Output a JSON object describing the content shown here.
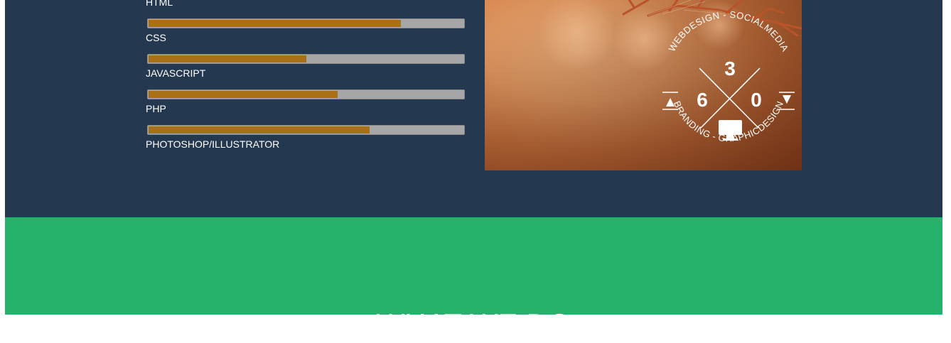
{
  "skills": {
    "items": [
      {
        "label": "HTML",
        "level_percent": 80
      },
      {
        "label": "CSS",
        "level_percent": 50
      },
      {
        "label": "JAVASCRIPT",
        "level_percent": 60
      },
      {
        "label": "PHP",
        "level_percent": 70
      },
      {
        "label": "PHOTOSHOP/ILLUSTRATOR"
      }
    ]
  },
  "logo": {
    "arc_top": "WEBDESIGN - SOCIALMEDIA",
    "arc_bottom": "BRANDING - GRAPHICDESIGN",
    "digit_top": "3",
    "digit_left": "6",
    "digit_right": "0",
    "icon": "monitor-icon"
  },
  "what_we_do": {
    "title": "WHAT WE DO"
  },
  "colors": {
    "skills_bg": "#243850",
    "bar_fill": "#aa7016",
    "bar_track": "#a6a6a6",
    "green_bg": "#26b26a"
  }
}
